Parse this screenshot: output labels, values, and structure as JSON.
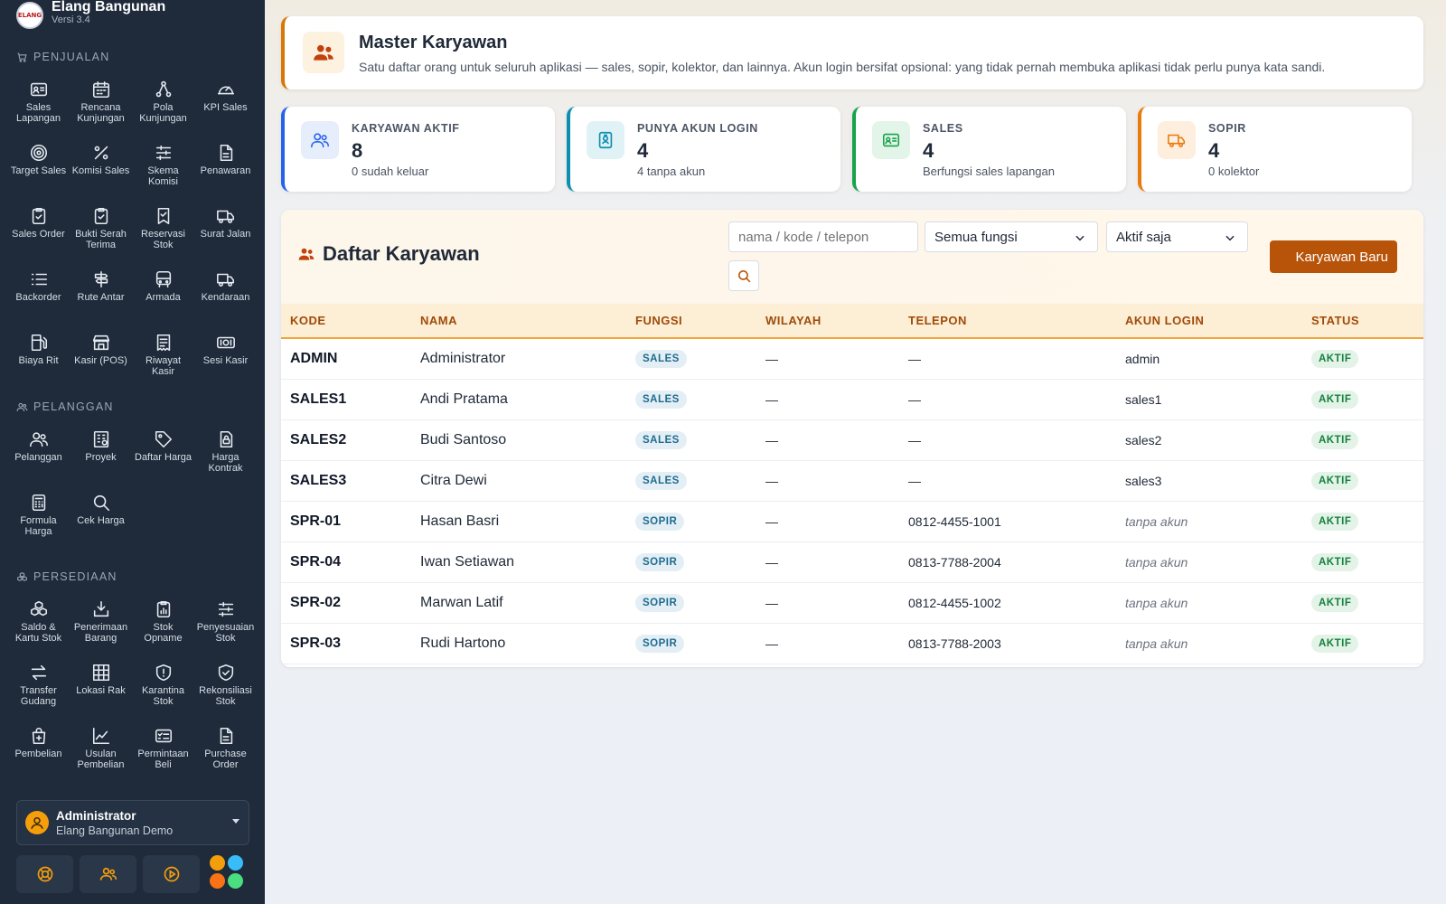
{
  "app": {
    "name": "Elang Bangunan",
    "version": "Versi 3.4",
    "logo_text": "ELANG"
  },
  "sidebar": {
    "sections": [
      {
        "title": "PENJUALAN",
        "items": [
          {
            "label": "Sales Lapangan",
            "icon": "id-card-icon"
          },
          {
            "label": "Rencana Kunjungan",
            "icon": "calendar-icon"
          },
          {
            "label": "Pola Kunjungan",
            "icon": "route-nodes-icon"
          },
          {
            "label": "KPI Sales",
            "icon": "gauge-icon"
          },
          {
            "label": "Target Sales",
            "icon": "target-icon"
          },
          {
            "label": "Komisi Sales",
            "icon": "percent-icon"
          },
          {
            "label": "Skema Komisi",
            "icon": "sliders-icon"
          },
          {
            "label": "Penawaran",
            "icon": "document-icon"
          },
          {
            "label": "Sales Order",
            "icon": "clipboard-check-icon"
          },
          {
            "label": "Bukti Serah Terima",
            "icon": "clipboard-check-icon"
          },
          {
            "label": "Reservasi Stok",
            "icon": "bookmark-icon"
          },
          {
            "label": "Surat Jalan",
            "icon": "truck-icon"
          },
          {
            "label": "Backorder",
            "icon": "list-icon"
          },
          {
            "label": "Rute Antar",
            "icon": "signpost-icon"
          },
          {
            "label": "Armada",
            "icon": "bus-icon"
          },
          {
            "label": "Kendaraan",
            "icon": "truck-icon"
          },
          {
            "label": "Biaya Rit",
            "icon": "fuel-icon"
          },
          {
            "label": "Kasir (POS)",
            "icon": "store-icon"
          },
          {
            "label": "Riwayat Kasir",
            "icon": "receipt-icon"
          },
          {
            "label": "Sesi Kasir",
            "icon": "cash-icon"
          }
        ]
      },
      {
        "title": "PELANGGAN",
        "items": [
          {
            "label": "Pelanggan",
            "icon": "users-icon"
          },
          {
            "label": "Proyek",
            "icon": "building-icon"
          },
          {
            "label": "Daftar Harga",
            "icon": "tag-icon"
          },
          {
            "label": "Harga Kontrak",
            "icon": "lock-file-icon"
          },
          {
            "label": "Formula Harga",
            "icon": "calculator-icon"
          },
          {
            "label": "Cek Harga",
            "icon": "search-icon"
          }
        ]
      },
      {
        "title": "PERSEDIAAN",
        "items": [
          {
            "label": "Saldo & Kartu Stok",
            "icon": "boxes-icon"
          },
          {
            "label": "Penerimaan Barang",
            "icon": "inbox-download-icon"
          },
          {
            "label": "Stok Opname",
            "icon": "clipboard-chart-icon"
          },
          {
            "label": "Penyesuaian Stok",
            "icon": "sliders-icon"
          },
          {
            "label": "Transfer Gudang",
            "icon": "arrows-swap-icon"
          },
          {
            "label": "Lokasi Rak",
            "icon": "grid-icon"
          },
          {
            "label": "Karantina Stok",
            "icon": "shield-alert-icon"
          },
          {
            "label": "Rekonsiliasi Stok",
            "icon": "shield-check-icon"
          },
          {
            "label": "Pembelian",
            "icon": "bag-plus-icon"
          },
          {
            "label": "Usulan Pembelian",
            "icon": "chart-line-icon"
          },
          {
            "label": "Permintaan Beli",
            "icon": "checklist-icon"
          },
          {
            "label": "Purchase Order",
            "icon": "document-icon"
          }
        ]
      }
    ]
  },
  "user": {
    "name": "Administrator",
    "org": "Elang Bangunan Demo"
  },
  "bottom_buttons": [
    {
      "icon": "lifebuoy-icon"
    },
    {
      "icon": "users-icon"
    },
    {
      "icon": "play-circle-icon"
    }
  ],
  "theme_dots": [
    "#f59e0b",
    "#38bdf8",
    "#f97316",
    "#4ade80"
  ],
  "header": {
    "title": "Master Karyawan",
    "subtitle": "Satu daftar orang untuk seluruh aplikasi — sales, sopir, kolektor, dan lainnya. Akun login bersifat opsional: yang tidak pernah membuka aplikasi tidak perlu punya kata sandi."
  },
  "stats": [
    {
      "label": "KARYAWAN AKTIF",
      "value": "8",
      "sub": "0 sudah keluar",
      "color": "#2563eb",
      "bg": "#e6edfb",
      "icon": "users-icon"
    },
    {
      "label": "PUNYA AKUN LOGIN",
      "value": "4",
      "sub": "4 tanpa akun",
      "color": "#0e8fb0",
      "bg": "#e1f2f7",
      "icon": "badge-icon"
    },
    {
      "label": "SALES",
      "value": "4",
      "sub": "Berfungsi sales lapangan",
      "color": "#16a34a",
      "bg": "#e3f4e8",
      "icon": "id-card-icon"
    },
    {
      "label": "SOPIR",
      "value": "4",
      "sub": "0 kolektor",
      "color": "#ea7a0c",
      "bg": "#fdeedd",
      "icon": "truck-icon"
    }
  ],
  "list": {
    "title": "Daftar Karyawan",
    "search_placeholder": "nama / kode / telepon",
    "filter_fungsi": "Semua fungsi",
    "filter_status": "Aktif saja",
    "new_button": "Karyawan Baru",
    "columns": [
      "KODE",
      "NAMA",
      "FUNGSI",
      "WILAYAH",
      "TELEPON",
      "AKUN LOGIN",
      "STATUS"
    ],
    "rows": [
      {
        "kode": "ADMIN",
        "nama": "Administrator",
        "fungsi": "SALES",
        "wilayah": "—",
        "telepon": "—",
        "akun": "admin",
        "akun_muted": false,
        "status": "AKTIF"
      },
      {
        "kode": "SALES1",
        "nama": "Andi Pratama",
        "fungsi": "SALES",
        "wilayah": "—",
        "telepon": "—",
        "akun": "sales1",
        "akun_muted": false,
        "status": "AKTIF"
      },
      {
        "kode": "SALES2",
        "nama": "Budi Santoso",
        "fungsi": "SALES",
        "wilayah": "—",
        "telepon": "—",
        "akun": "sales2",
        "akun_muted": false,
        "status": "AKTIF"
      },
      {
        "kode": "SALES3",
        "nama": "Citra Dewi",
        "fungsi": "SALES",
        "wilayah": "—",
        "telepon": "—",
        "akun": "sales3",
        "akun_muted": false,
        "status": "AKTIF"
      },
      {
        "kode": "SPR-01",
        "nama": "Hasan Basri",
        "fungsi": "SOPIR",
        "wilayah": "—",
        "telepon": "0812-4455-1001",
        "akun": "tanpa akun",
        "akun_muted": true,
        "status": "AKTIF"
      },
      {
        "kode": "SPR-04",
        "nama": "Iwan Setiawan",
        "fungsi": "SOPIR",
        "wilayah": "—",
        "telepon": "0813-7788-2004",
        "akun": "tanpa akun",
        "akun_muted": true,
        "status": "AKTIF"
      },
      {
        "kode": "SPR-02",
        "nama": "Marwan Latif",
        "fungsi": "SOPIR",
        "wilayah": "—",
        "telepon": "0812-4455-1002",
        "akun": "tanpa akun",
        "akun_muted": true,
        "status": "AKTIF"
      },
      {
        "kode": "SPR-03",
        "nama": "Rudi Hartono",
        "fungsi": "SOPIR",
        "wilayah": "—",
        "telepon": "0813-7788-2003",
        "akun": "tanpa akun",
        "akun_muted": true,
        "status": "AKTIF"
      }
    ]
  }
}
